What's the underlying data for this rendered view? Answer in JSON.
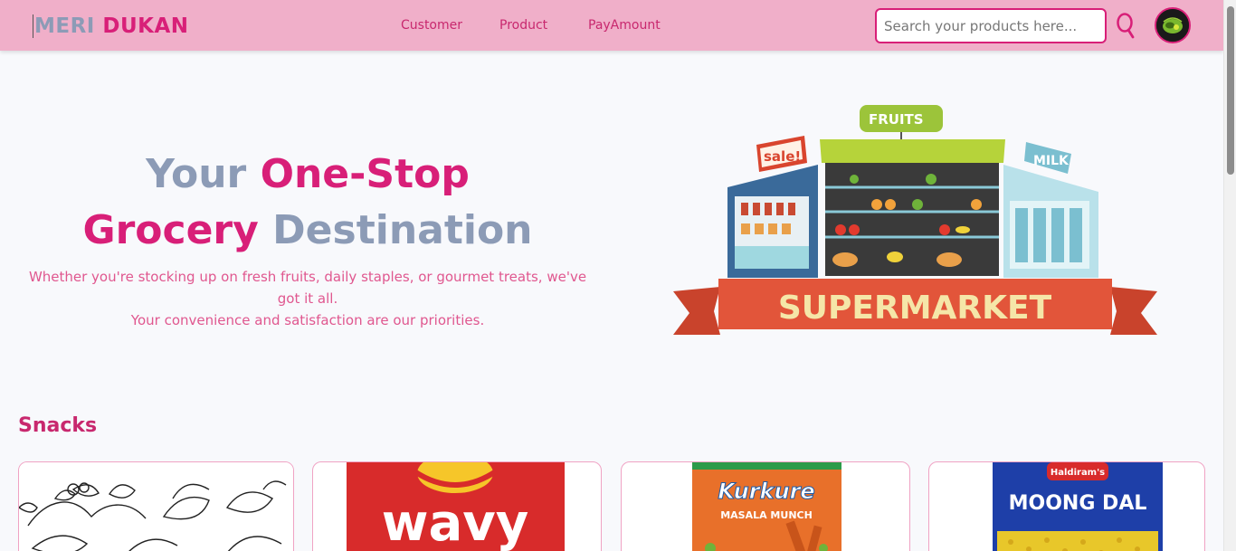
{
  "brand": {
    "part1": "MERI",
    "part2": "DUKAN"
  },
  "nav": {
    "customer": "Customer",
    "product": "Product",
    "pay_amount": "PayAmount"
  },
  "search": {
    "placeholder": "Search your products here..."
  },
  "hero": {
    "title_part1": "Your",
    "title_part2": "One-Stop",
    "title_part3": "Grocery",
    "title_part4": "Destination",
    "subtitle_line1": "Whether you're stocking up on fresh fruits, daily staples, or gourmet treats, we've got it all.",
    "subtitle_line2": "Your convenience and satisfaction are our priorities.",
    "illustration": {
      "sign_fruits": "FRUITS",
      "sign_sale": "sale!",
      "sign_milk": "MILK",
      "banner": "SUPERMARKET"
    }
  },
  "snacks": {
    "title": "Snacks",
    "products": [
      {
        "image": "line-art-leaves",
        "label": ""
      },
      {
        "image": "lays-wavy-pack",
        "label": "wavy"
      },
      {
        "image": "kurkure-pack",
        "label": "Kurkure",
        "sublabel": "MASALA MUNCH"
      },
      {
        "image": "haldirams-pack",
        "label": "MOONG DAL",
        "brand": "Haldiram's"
      }
    ]
  },
  "colors": {
    "navbar": "#f0afc9",
    "accent_pink": "#d81f78",
    "accent_grey": "#8c9bb6",
    "background": "#f8f9fc"
  }
}
